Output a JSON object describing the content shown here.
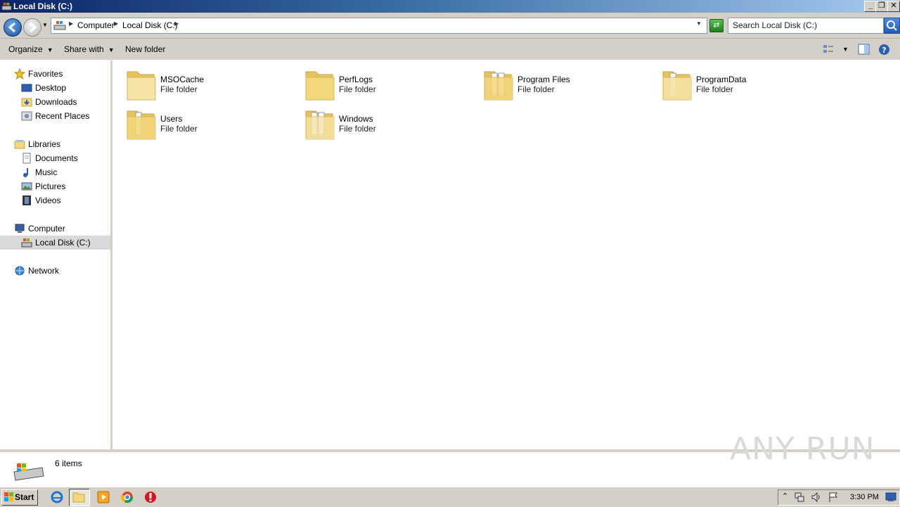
{
  "window": {
    "title": "Local Disk (C:)"
  },
  "address": {
    "crumbs": [
      "Computer",
      "Local Disk (C:)"
    ],
    "search_placeholder": "Search Local Disk (C:)"
  },
  "toolbar": {
    "organize": "Organize",
    "share_with": "Share with",
    "new_folder": "New folder"
  },
  "sidebar": {
    "favorites": {
      "label": "Favorites",
      "items": [
        "Desktop",
        "Downloads",
        "Recent Places"
      ]
    },
    "libraries": {
      "label": "Libraries",
      "items": [
        "Documents",
        "Music",
        "Pictures",
        "Videos"
      ]
    },
    "computer": {
      "label": "Computer",
      "items": [
        "Local Disk (C:)"
      ]
    },
    "network": {
      "label": "Network"
    }
  },
  "files": [
    {
      "name": "MSOCache",
      "type": "File folder"
    },
    {
      "name": "PerfLogs",
      "type": "File folder"
    },
    {
      "name": "Program Files",
      "type": "File folder"
    },
    {
      "name": "ProgramData",
      "type": "File folder"
    },
    {
      "name": "Users",
      "type": "File folder"
    },
    {
      "name": "Windows",
      "type": "File folder"
    }
  ],
  "status": {
    "count": "6 items"
  },
  "watermark": "ANY RUN",
  "taskbar": {
    "start_label": "Start",
    "clock": "3:30 PM"
  },
  "colors": {
    "folder": "#f3d77a",
    "selection": "#d9d9d9",
    "chrome": "#d4d0c8"
  }
}
